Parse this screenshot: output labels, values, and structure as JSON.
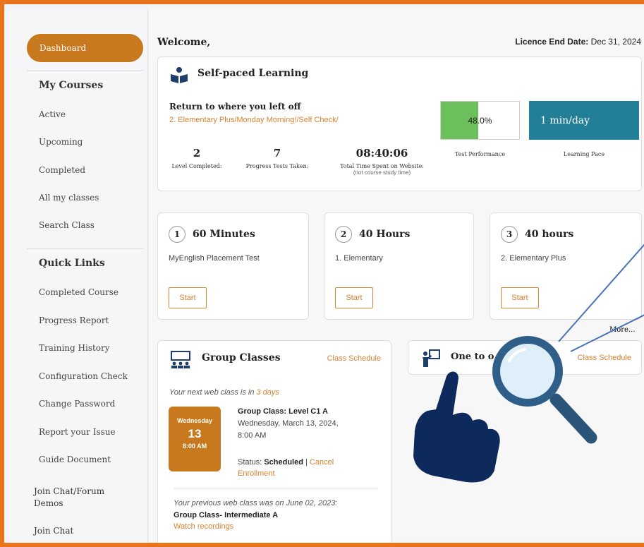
{
  "sidebar": {
    "dashboard": "Dashboard",
    "my_courses_heading": "My Courses",
    "course_items": [
      "Active",
      "Upcoming",
      "Completed",
      "All my classes",
      "Search Class"
    ],
    "quick_links_heading": "Quick Links",
    "quick_links": [
      "Completed Course",
      "Progress Report",
      "Training History",
      "Configuration Check",
      "Change Password",
      "Report your Issue",
      "Guide Document"
    ],
    "join_chat_forum": "Join Chat/Forum",
    "demos": "Demos",
    "join_chat": "Join Chat"
  },
  "header": {
    "welcome": "Welcome,",
    "licence_label": "Licence End Date:",
    "licence_date": "Dec 31, 2024"
  },
  "self_paced": {
    "title": "Self-paced Learning",
    "return_label": "Return to where you left off",
    "return_link": "2. Elementary Plus/Monday Morning!/Self Check/",
    "stats": [
      {
        "value": "2",
        "label": "Level Completed:"
      },
      {
        "value": "7",
        "label": "Progress Tests Taken:"
      },
      {
        "value": "08:40:06",
        "label": "Total Time Spent on Website:",
        "sub": "(not course study time)"
      }
    ],
    "test_performance_value": "48.0%",
    "test_performance_fraction": 0.48,
    "test_performance_label": "Test Performance",
    "learning_pace_value": "1 min/day",
    "learning_pace_label": "Learning Pace"
  },
  "courses": [
    {
      "num": "1",
      "duration": "60 Minutes",
      "name": "MyEnglish Placement Test",
      "button": "Start"
    },
    {
      "num": "2",
      "duration": "40 Hours",
      "name": "1. Elementary",
      "button": "Start"
    },
    {
      "num": "3",
      "duration": "40 hours",
      "name": "2. Elementary Plus",
      "button": "Start"
    }
  ],
  "more_link": "More...",
  "group_classes": {
    "title": "Group Classes",
    "schedule_link": "Class Schedule",
    "next_prefix": "Your next web class is in ",
    "next_days": "3 days",
    "date_weekday": "Wednesday",
    "date_day": "13",
    "date_time": "8:00 AM",
    "class_title": "Group Class: Level C1 A",
    "class_date": "Wednesday, March 13, 2024,",
    "class_time": "8:00 AM",
    "status_label": "Status:",
    "status_value": "Scheduled",
    "status_sep": "|",
    "cancel_link": "Cancel",
    "enrollment_link": "Enrollment",
    "previous_text": "Your previous web class was on June 02, 2023:",
    "previous_class": "Group Class- Intermediate A",
    "recordings_link": "Watch recordings"
  },
  "one_to_one": {
    "title": "One to o",
    "schedule_link": "Class Schedule"
  },
  "colors": {
    "accent": "#d9812e",
    "sidebar_active": "#c8791e",
    "pace_box": "#227f97",
    "performance_fill": "#6cbf5a",
    "hand": "#0e2a5c",
    "magnifier": "#2f5f88"
  }
}
